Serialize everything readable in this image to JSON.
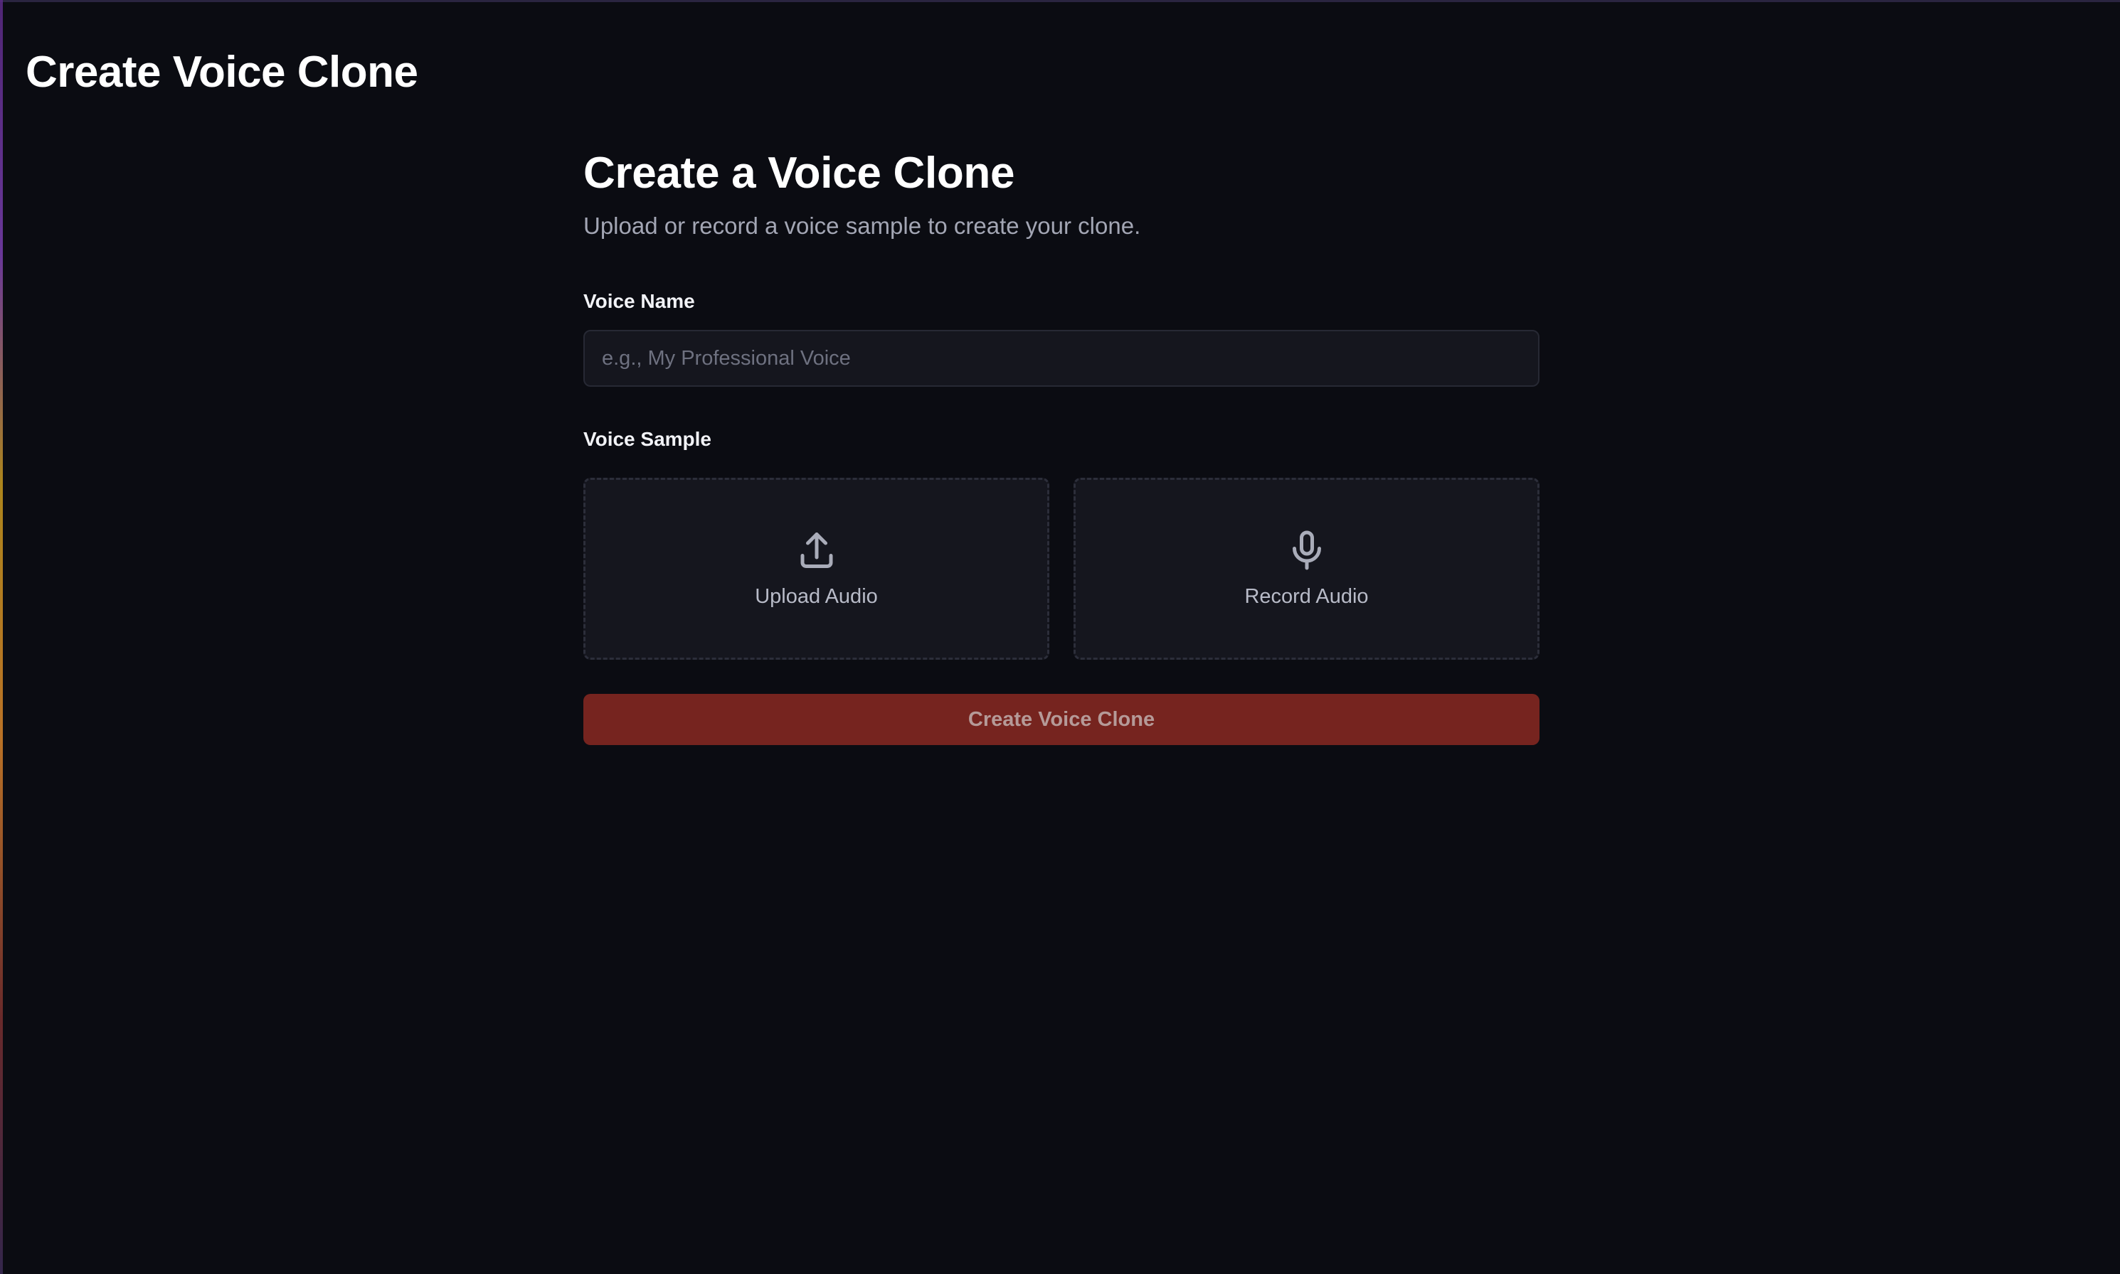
{
  "header": {
    "title": "Create Voice Clone"
  },
  "main": {
    "heading": "Create a Voice Clone",
    "subheading": "Upload or record a voice sample to create your clone.",
    "voice_name": {
      "label": "Voice Name",
      "value": "",
      "placeholder": "e.g., My Professional Voice"
    },
    "voice_sample": {
      "label": "Voice Sample",
      "options": [
        {
          "label": "Upload Audio",
          "icon": "upload-icon"
        },
        {
          "label": "Record Audio",
          "icon": "microphone-icon"
        }
      ]
    },
    "submit_label": "Create Voice Clone",
    "submit_disabled": true
  },
  "colors": {
    "background": "#0b0c12",
    "card": "#15161e",
    "accent": "#76241f",
    "muted_text": "#a3a6b4"
  }
}
